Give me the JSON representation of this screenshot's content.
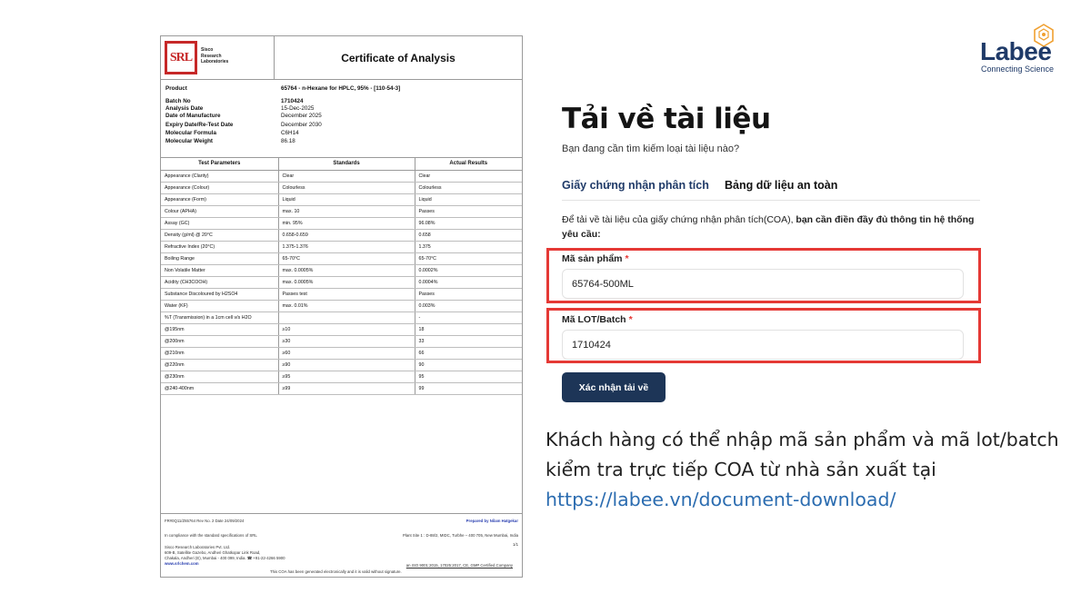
{
  "certificate": {
    "company_lines": [
      "Sisco",
      "Research",
      "Laboratories"
    ],
    "logo_text": "SRL",
    "title": "Certificate of Analysis",
    "info": [
      {
        "label": "Product",
        "value": "65764 - n-Hexane for HPLC, 95% - [110-54-3]",
        "bold": true
      },
      {
        "label": "Batch No",
        "value": "1710424",
        "bold": true
      },
      {
        "label": "Analysis Date",
        "value": "15-Dec-2025"
      },
      {
        "label": "Date of Manufacture",
        "value": "December 2025"
      },
      {
        "label": "Expiry Date/Re-Test Date",
        "value": "December 2030"
      },
      {
        "label": "Molecular Formula",
        "value": "C6H14"
      },
      {
        "label": "Molecular Weight",
        "value": "86.18"
      }
    ],
    "table_headers": [
      "Test Parameters",
      "Standards",
      "Actual Results"
    ],
    "rows": [
      [
        "Appearance (Clarity)",
        "Clear",
        "Clear"
      ],
      [
        "Appearance (Colour)",
        "Colourless",
        "Colourless"
      ],
      [
        "Appearance (Form)",
        "Liquid",
        "Liquid"
      ],
      [
        "Colour (APHA)",
        "max. 10",
        "Passes"
      ],
      [
        "Assay (GC)",
        "min. 95%",
        "96.08%"
      ],
      [
        "Density (g/ml) @ 20°C",
        "0.658-0.659",
        "0.658"
      ],
      [
        "Refractive Index (20°C)",
        "1.375-1.376",
        "1.375"
      ],
      [
        "Boiling Range",
        "65-70°C",
        "65-70°C"
      ],
      [
        "Non Volatile Matter",
        "max. 0.0005%",
        "0.0002%"
      ],
      [
        "Acidity (CH3COOH)",
        "max. 0.0005%",
        "0.0004%"
      ],
      [
        "Substance Discoloured by H2SO4",
        "Passes test",
        "Passes"
      ],
      [
        "Water (KF)",
        "max. 0.01%",
        "0.003%"
      ],
      [
        "%T (Transmission) in a 1cm cell v/s H2O",
        "",
        "-"
      ],
      [
        "@195nm",
        "≥10",
        "18"
      ],
      [
        "@200nm",
        "≥30",
        "33"
      ],
      [
        "@210nm",
        "≥60",
        "66"
      ],
      [
        "@220nm",
        "≥90",
        "90"
      ],
      [
        "@230nm",
        "≥95",
        "95"
      ],
      [
        "@240-400nm",
        "≥99",
        "99"
      ]
    ],
    "footer": {
      "form_no": "FR#0Q11/Z65764 Rev No. 2 Date 24/09/2024",
      "prepared_by": "Prepared by  Nilam Hatgekar",
      "compliance": "In compliance with the standard specifications of SRL",
      "plant": "Plant Site 1 : D-88/2, MIDC, Turbhe – 400 705, New Mumbai, India",
      "page": "1/1",
      "address1": "Sisco Research Laboratories Pvt. Ltd.",
      "address2": "609-B, Satellite Gazebo, Andheri Ghatkopar Link Road,",
      "address3": "Chakala, Andheri (E), Mumbai - 400 099, India. ☎ +91-22-4266 5900",
      "website": "www.srlchem.com",
      "cert": "an ISO 9001:2015, 17025:2017, CE, GMP Certified Company",
      "note": "This COA has been generated electronically and it is valid without signature."
    }
  },
  "brand": {
    "name": "Labee",
    "tagline": "Connecting Science",
    "icon": "bee-hexagon-icon",
    "color": "#1f3a68",
    "accent": "#f0a030"
  },
  "download": {
    "title": "Tải về tài liệu",
    "subtitle": "Bạn đang cần tìm kiếm loại tài liệu nào?",
    "tabs": [
      "Giấy chứng nhận phân tích",
      "Bảng dữ liệu an toàn"
    ],
    "instruction_plain": "Để tải về tài liệu của giấy chứng nhận phân tích(COA), ",
    "instruction_bold": "bạn cần điền đầy đủ thông tin hệ thống yêu cầu:",
    "product_label": "Mã sản phẩm",
    "product_value": "65764-500ML",
    "lot_label": "Mã LOT/Batch",
    "lot_value": "1710424",
    "required_mark": "*",
    "button": "Xác nhận tải về",
    "highlight_color": "#e53935",
    "button_color": "#1d3557"
  },
  "caption": {
    "text": "Khách hàng có thể nhập mã sản phẩm và mã lot/batch kiểm tra trực tiếp COA từ nhà sản xuất tại",
    "url": "https://labee.vn/document-download/"
  }
}
